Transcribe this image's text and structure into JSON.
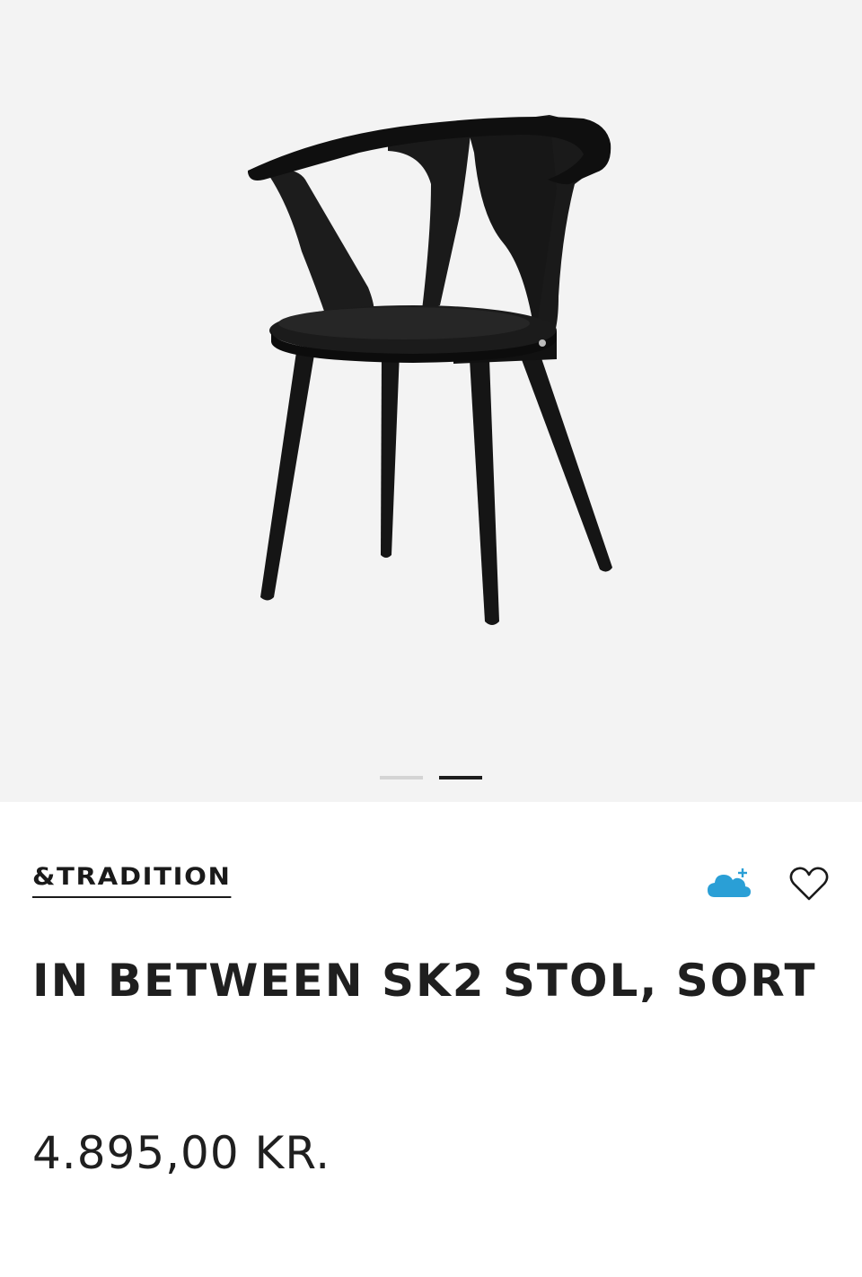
{
  "product": {
    "brand": "&TRADITION",
    "title": "IN BETWEEN SK2 STOL, SORT",
    "price": "4.895,00 KR."
  },
  "gallery": {
    "image_count": 2,
    "active_index": 1,
    "background_color": "#f3f3f3"
  },
  "actions": {
    "cloud_icon": "cloud-plus-icon",
    "cloud_color": "#2a9fd6",
    "favorite_icon": "heart-outline-icon"
  }
}
